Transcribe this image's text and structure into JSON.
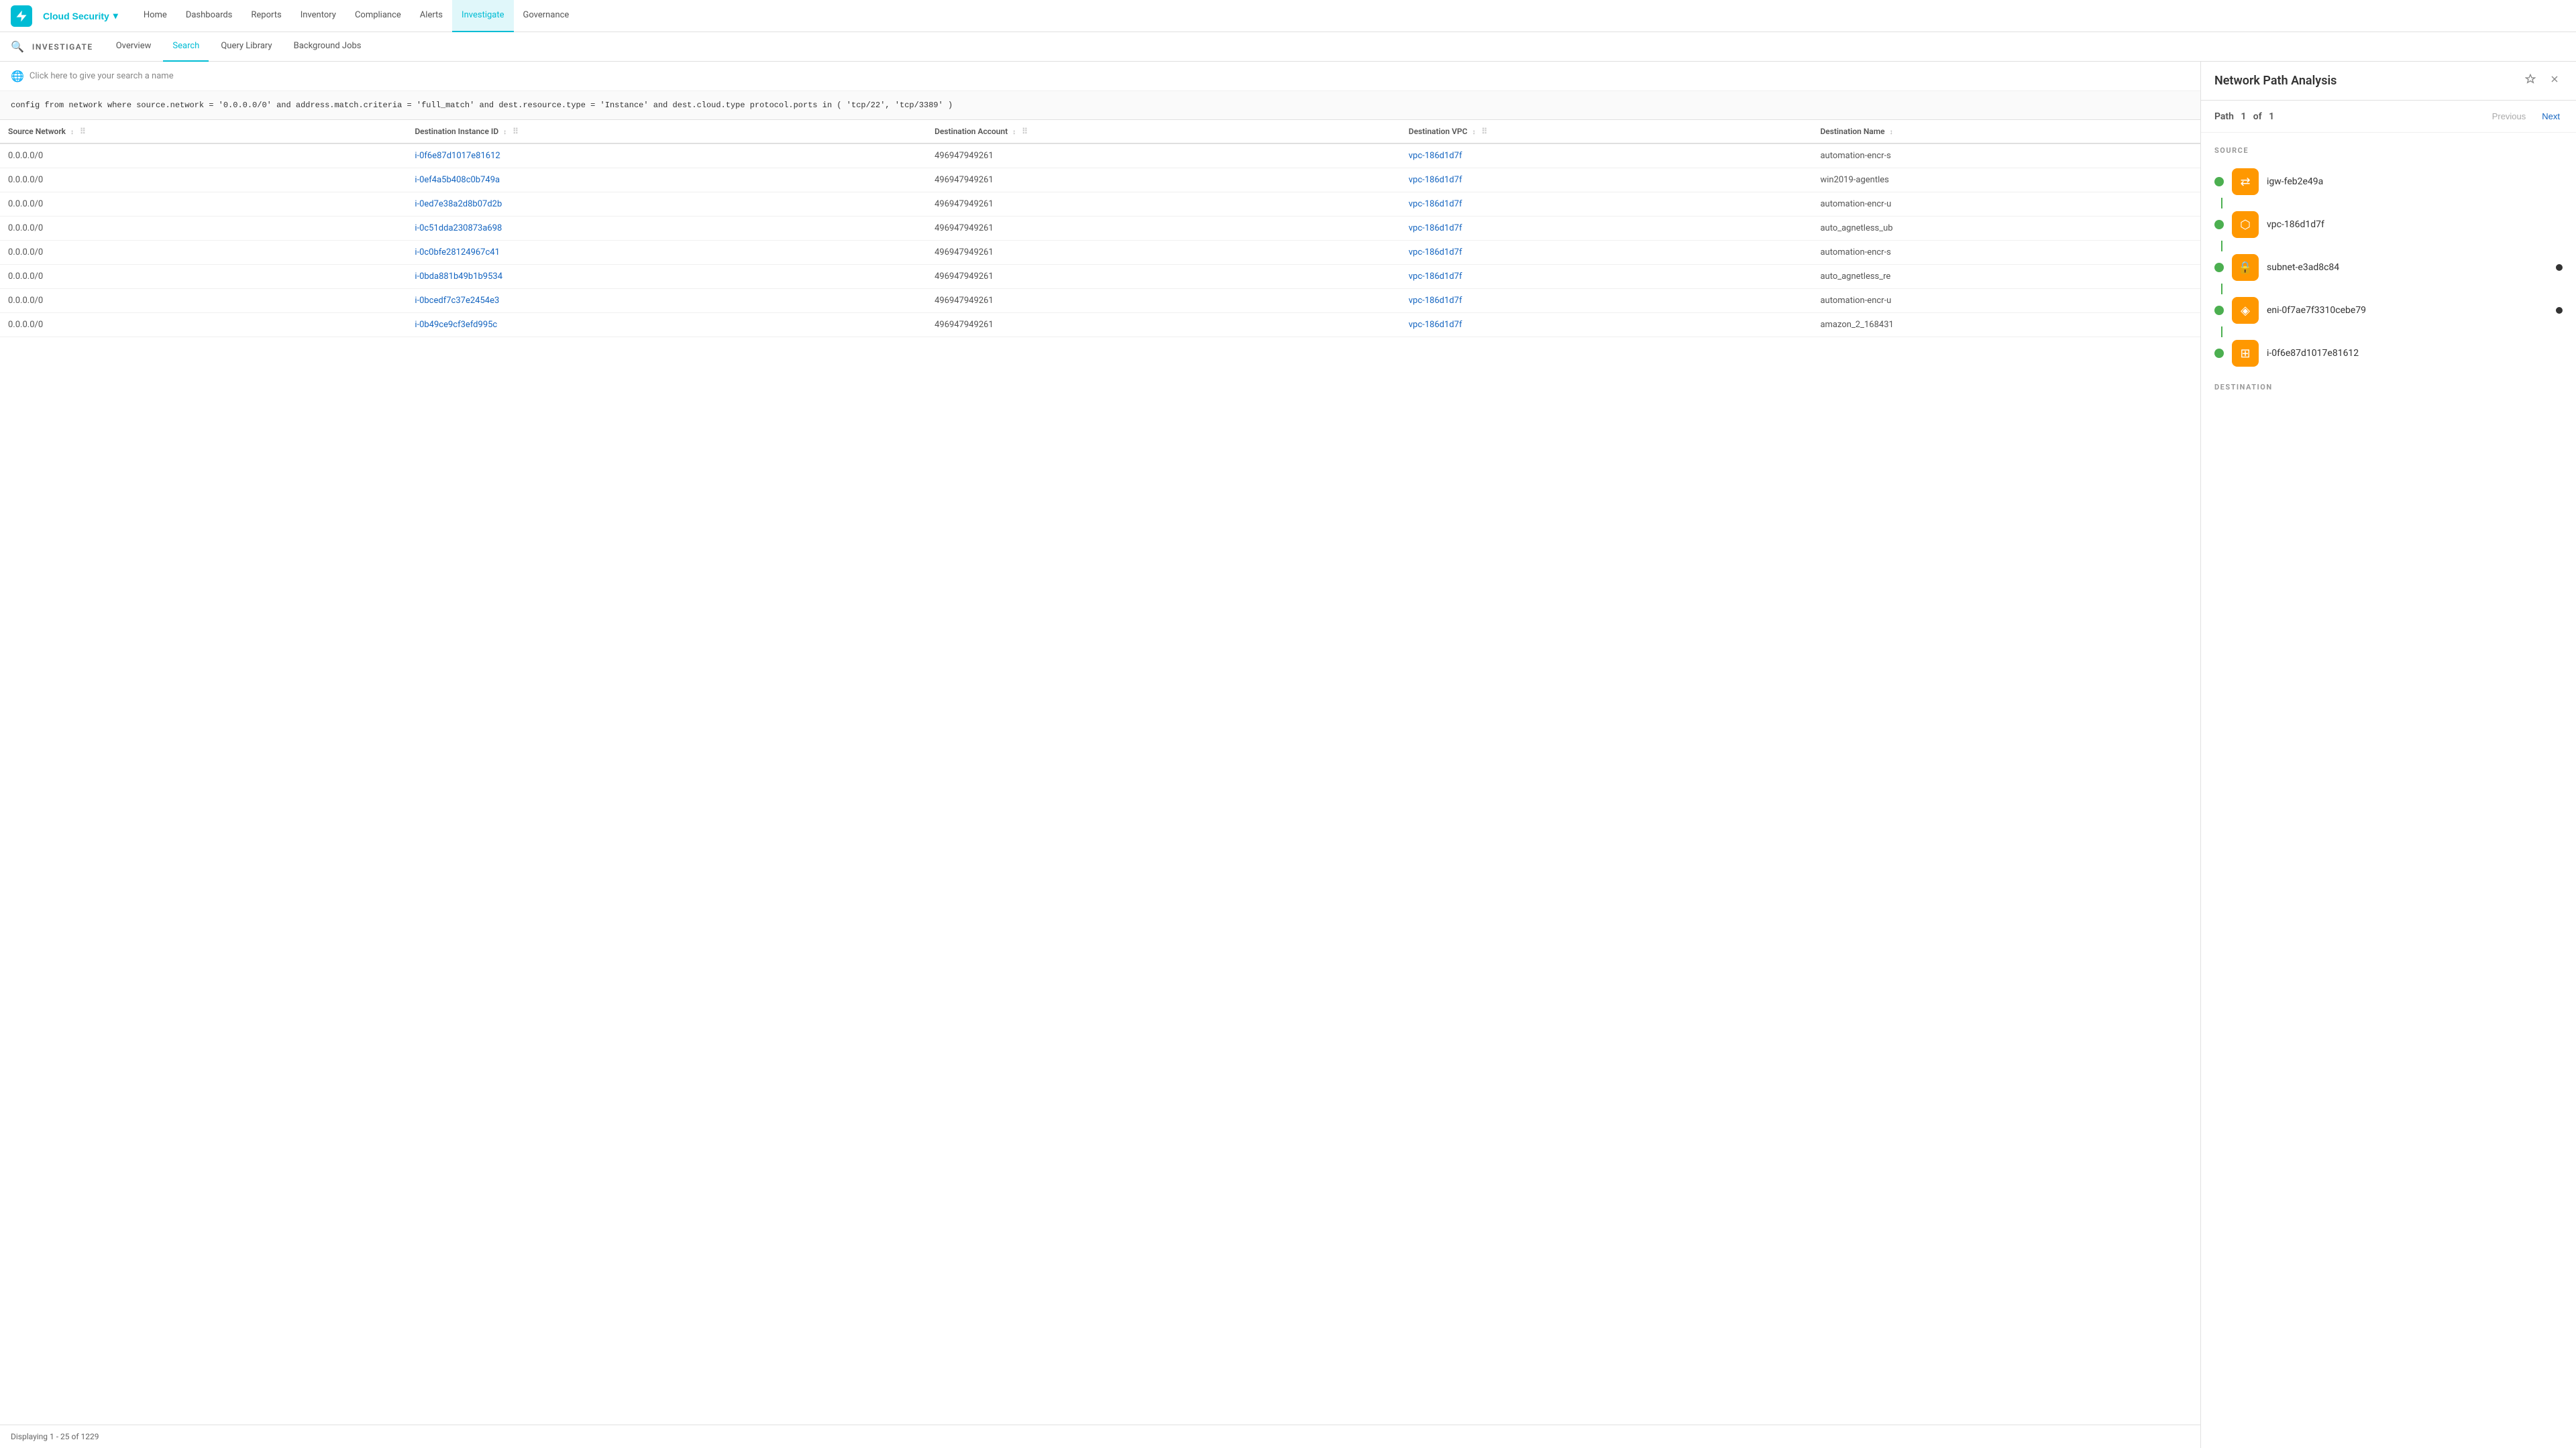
{
  "topNav": {
    "logo": "prisma-logo",
    "cloudSecurity": "Cloud Security",
    "items": [
      {
        "label": "Home",
        "active": false
      },
      {
        "label": "Dashboards",
        "active": false
      },
      {
        "label": "Reports",
        "active": false
      },
      {
        "label": "Inventory",
        "active": false
      },
      {
        "label": "Compliance",
        "active": false
      },
      {
        "label": "Alerts",
        "active": false
      },
      {
        "label": "Investigate",
        "active": true
      },
      {
        "label": "Governance",
        "active": false
      }
    ]
  },
  "subNav": {
    "title": "INVESTIGATE",
    "tabs": [
      {
        "label": "Overview",
        "active": false
      },
      {
        "label": "Search",
        "active": true
      },
      {
        "label": "Query Library",
        "active": false
      },
      {
        "label": "Background Jobs",
        "active": false
      }
    ]
  },
  "searchBar": {
    "placeholder": "Click here to give your search a name"
  },
  "query": {
    "text": "config from network where source.network = '0.0.0.0/0' and address.match.criteria = 'full_match' and dest.resource.type = 'Instance' and dest.cloud.type protocol.ports in ( 'tcp/22', 'tcp/3389' )"
  },
  "table": {
    "columns": [
      {
        "label": "Source Network",
        "sortable": true
      },
      {
        "label": "Destination Instance ID",
        "sortable": true
      },
      {
        "label": "Destination Account",
        "sortable": true
      },
      {
        "label": "Destination VPC",
        "sortable": true
      },
      {
        "label": "Destination Name",
        "sortable": true
      }
    ],
    "rows": [
      {
        "source": "0.0.0.0/0",
        "destId": "i-0f6e87d1017e81612",
        "destAccount": "496947949261",
        "destVpc": "vpc-186d1d7f",
        "destName": "automation-encr-s"
      },
      {
        "source": "0.0.0.0/0",
        "destId": "i-0ef4a5b408c0b749a",
        "destAccount": "496947949261",
        "destVpc": "vpc-186d1d7f",
        "destName": "win2019-agentles"
      },
      {
        "source": "0.0.0.0/0",
        "destId": "i-0ed7e38a2d8b07d2b",
        "destAccount": "496947949261",
        "destVpc": "vpc-186d1d7f",
        "destName": "automation-encr-u"
      },
      {
        "source": "0.0.0.0/0",
        "destId": "i-0c51dda230873a698",
        "destAccount": "496947949261",
        "destVpc": "vpc-186d1d7f",
        "destName": "auto_agnetless_ub"
      },
      {
        "source": "0.0.0.0/0",
        "destId": "i-0c0bfe28124967c41",
        "destAccount": "496947949261",
        "destVpc": "vpc-186d1d7f",
        "destName": "automation-encr-s"
      },
      {
        "source": "0.0.0.0/0",
        "destId": "i-0bda881b49b1b9534",
        "destAccount": "496947949261",
        "destVpc": "vpc-186d1d7f",
        "destName": "auto_agnetless_re"
      },
      {
        "source": "0.0.0.0/0",
        "destId": "i-0bcedf7c37e2454e3",
        "destAccount": "496947949261",
        "destVpc": "vpc-186d1d7f",
        "destName": "automation-encr-u"
      },
      {
        "source": "0.0.0.0/0",
        "destId": "i-0b49ce9cf3efd995c",
        "destAccount": "496947949261",
        "destVpc": "vpc-186d1d7f",
        "destName": "amazon_2_168431"
      }
    ],
    "footer": "Displaying 1 - 25 of 1229"
  },
  "rightPanel": {
    "title": "Network Path Analysis",
    "pathLabel": "Path",
    "pathCurrent": "1",
    "pathOf": "of",
    "pathTotal": "1",
    "prevBtn": "Previous",
    "nextBtn": "Next",
    "sourceLabel": "SOURCE",
    "destinationLabel": "DESTINATION",
    "nodes": [
      {
        "id": "igw-feb2e49a",
        "icon": "gateway-icon",
        "type": "igw",
        "hasSideDot": false
      },
      {
        "id": "vpc-186d1d7f",
        "icon": "vpc-icon",
        "type": "vpc",
        "hasSideDot": false
      },
      {
        "id": "subnet-e3ad8c84",
        "icon": "subnet-icon",
        "type": "subnet",
        "hasSideDot": true
      },
      {
        "id": "eni-0f7ae7f3310cebe79",
        "icon": "eni-icon",
        "type": "eni",
        "hasSideDot": true
      },
      {
        "id": "i-0f6e87d1017e81612",
        "icon": "instance-icon",
        "type": "instance",
        "hasSideDot": false
      }
    ]
  }
}
